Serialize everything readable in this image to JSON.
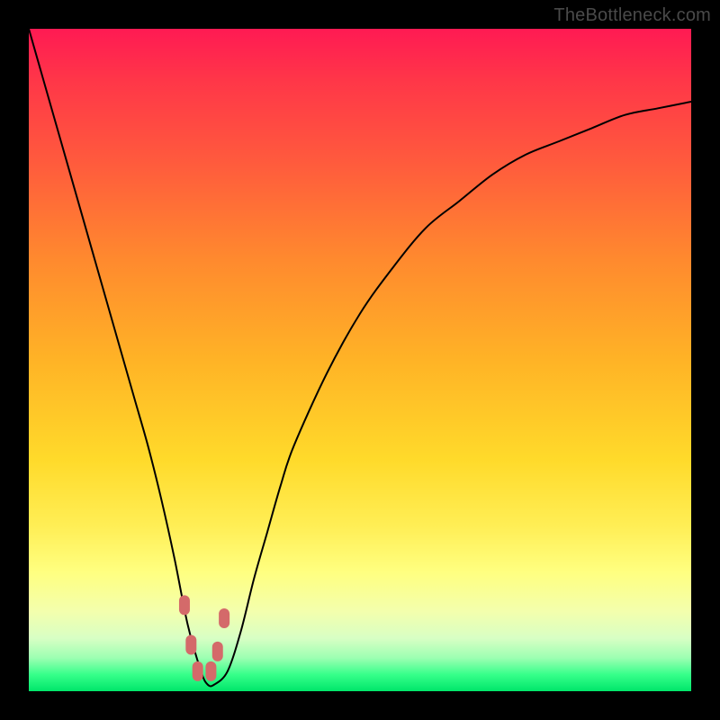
{
  "watermark": "TheBottleneck.com",
  "colors": {
    "frame": "#000000",
    "curve": "#000000",
    "marker": "#d46a6a",
    "gradient_top": "#ff1a53",
    "gradient_bottom": "#00e66a"
  },
  "chart_data": {
    "type": "line",
    "title": "",
    "xlabel": "",
    "ylabel": "",
    "xlim": [
      0,
      100
    ],
    "ylim": [
      0,
      100
    ],
    "grid": false,
    "x": [
      0,
      2,
      4,
      6,
      8,
      10,
      12,
      14,
      16,
      18,
      20,
      22,
      24,
      26,
      27,
      28,
      30,
      32,
      34,
      36,
      38,
      40,
      45,
      50,
      55,
      60,
      65,
      70,
      75,
      80,
      85,
      90,
      95,
      100
    ],
    "values": [
      100,
      93,
      86,
      79,
      72,
      65,
      58,
      51,
      44,
      37,
      29,
      20,
      10,
      3,
      1,
      1,
      3,
      9,
      17,
      24,
      31,
      37,
      48,
      57,
      64,
      70,
      74,
      78,
      81,
      83,
      85,
      87,
      88,
      89
    ],
    "markers": {
      "x": [
        23.5,
        24.5,
        25.5,
        27.5,
        28.5,
        29.5
      ],
      "y": [
        13,
        7,
        3,
        3,
        6,
        11
      ]
    },
    "note": "Axis values are estimated from pixel positions; chart has no visible tick labels."
  }
}
